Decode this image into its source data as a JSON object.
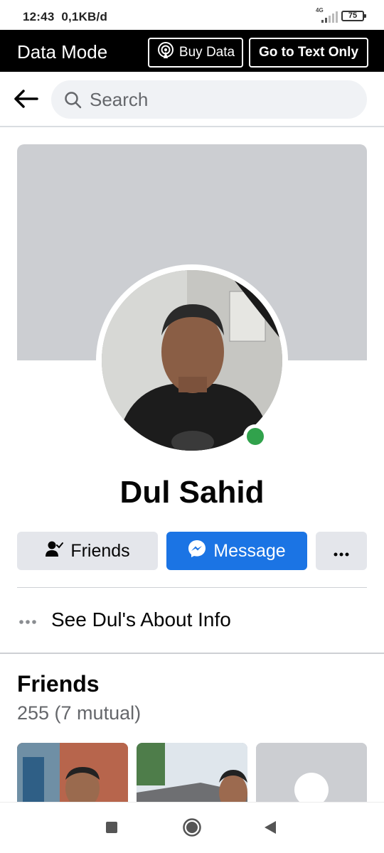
{
  "status_bar": {
    "time": "12:43",
    "net_speed": "0,1KB/d",
    "network_type": "4G",
    "battery": "75"
  },
  "data_mode_bar": {
    "title": "Data Mode",
    "buy_data_label": "Buy Data",
    "text_only_label": "Go to Text Only"
  },
  "search": {
    "placeholder": "Search"
  },
  "profile": {
    "name": "Dul Sahid",
    "online": true,
    "online_color": "#31a24c"
  },
  "actions": {
    "friends_label": "Friends",
    "message_label": "Message",
    "message_color": "#1b74e4"
  },
  "about": {
    "label": "See Dul's About Info"
  },
  "friends_section": {
    "title": "Friends",
    "count": "255 (7 mutual)"
  },
  "icons": [
    "back-arrow-icon",
    "search-icon",
    "broadcast-icon",
    "person-check-icon",
    "messenger-icon",
    "more-dots-icon",
    "recent-apps-icon",
    "home-icon",
    "back-triangle-icon"
  ]
}
